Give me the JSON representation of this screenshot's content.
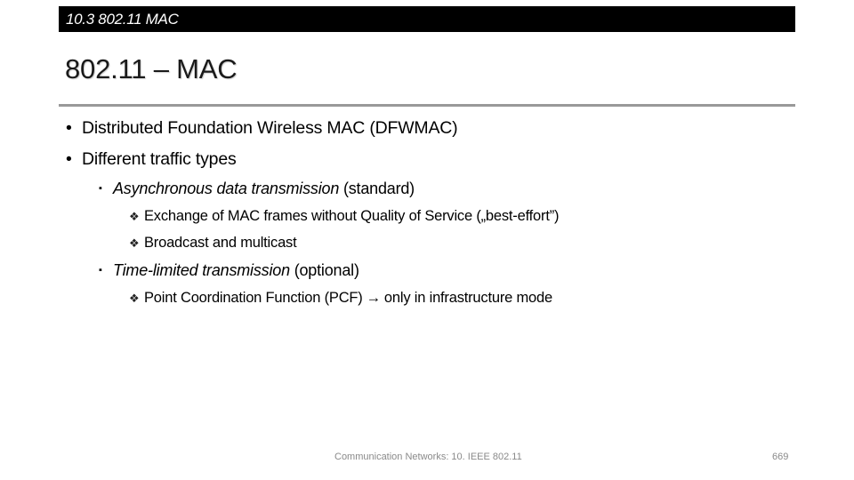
{
  "header": {
    "section_label": "10.3 802.11 MAC"
  },
  "slide": {
    "title": "802.11 – MAC",
    "bullets": [
      {
        "marker": "•",
        "text": "Distributed Foundation Wireless MAC (DFWMAC)"
      },
      {
        "marker": "•",
        "text": "Different traffic types"
      }
    ],
    "sub_bullets": [
      {
        "marker": "▪",
        "italic": "Asynchronous data transmission",
        "normal": " (standard)"
      },
      {
        "marker": "▪",
        "italic": "Time-limited transmission",
        "normal": " (optional)"
      }
    ],
    "sub_sub_bullets": [
      {
        "marker": "❖",
        "text": "Exchange of MAC frames without Quality of Service („best-effort”)"
      },
      {
        "marker": "❖",
        "text": "Broadcast and multicast"
      },
      {
        "marker": "❖",
        "text": "Point Coordination Function (PCF)",
        "arrow": "→",
        "after": "only in infrastructure mode"
      }
    ]
  },
  "footer": {
    "center_text": "Communication Networks: 10. IEEE 802.11",
    "page_number": "669"
  },
  "colors": {
    "header_bar": "#000000",
    "rule": "#999999",
    "footer_text": "#8a8a8a"
  }
}
